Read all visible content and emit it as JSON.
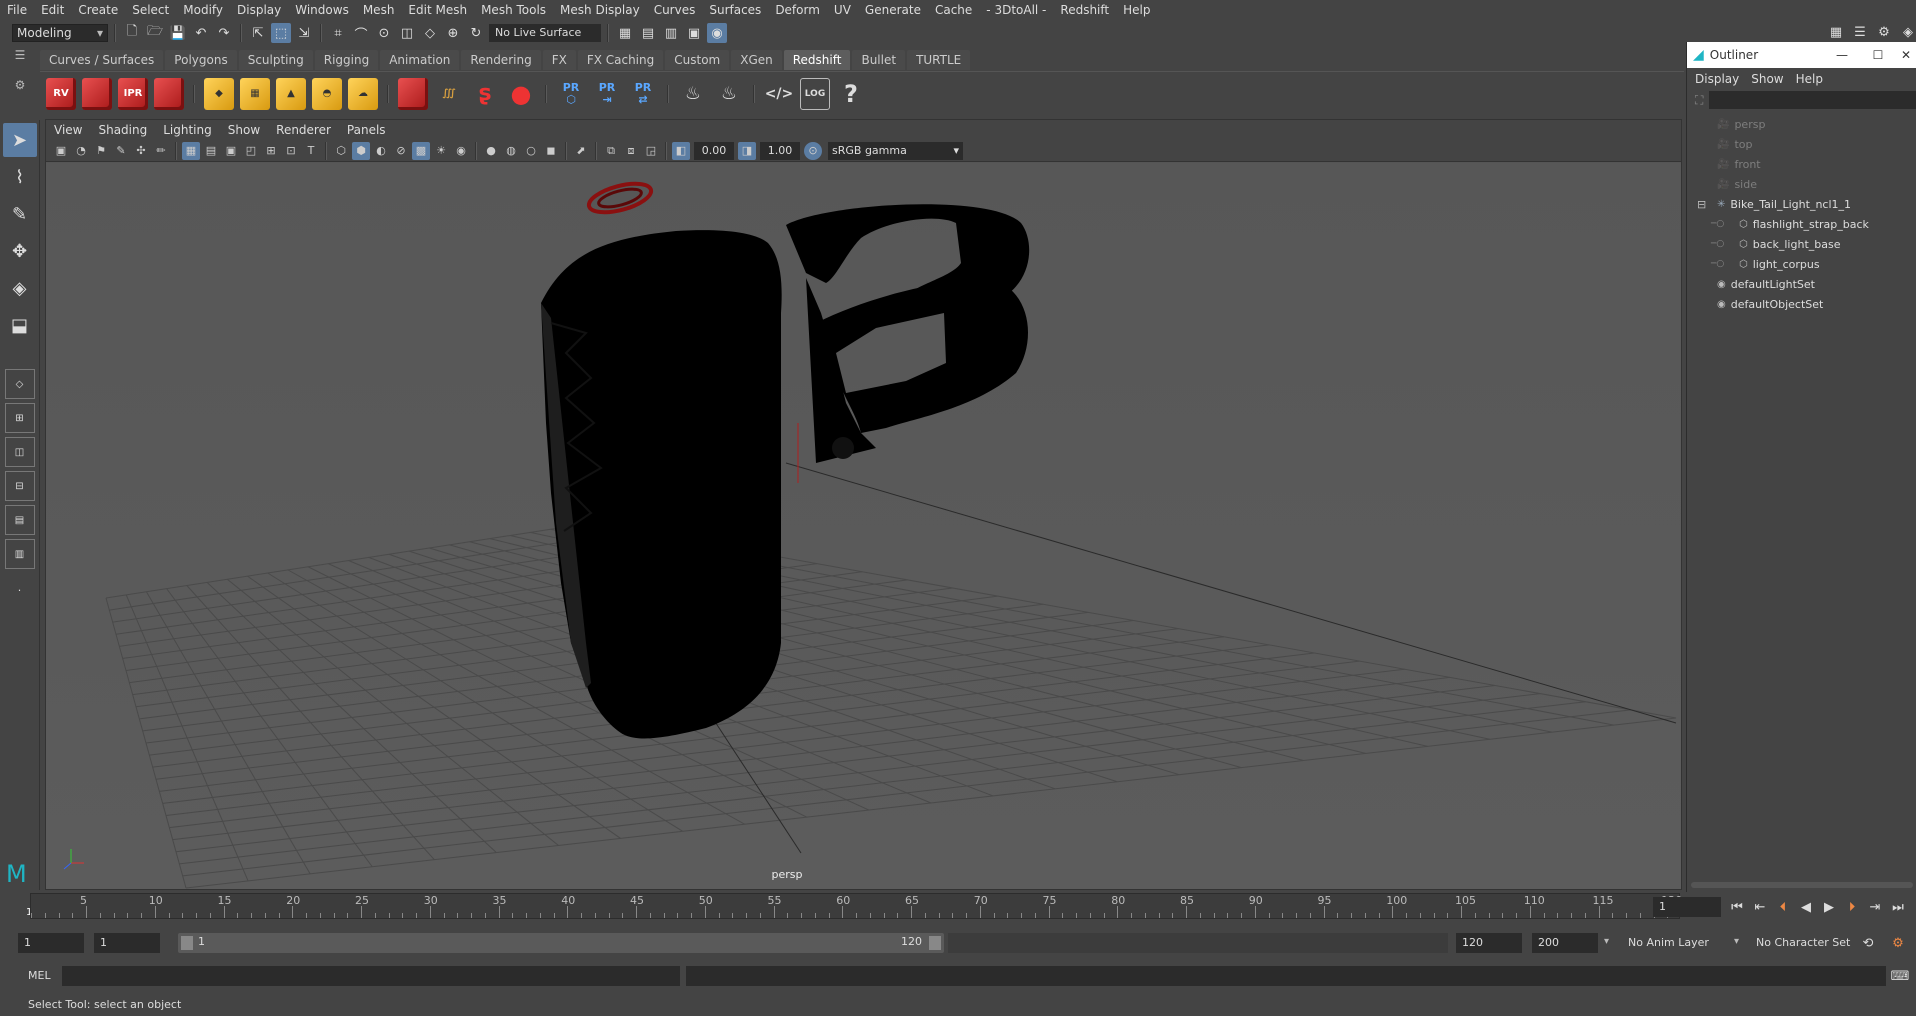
{
  "menubar": [
    "File",
    "Edit",
    "Create",
    "Select",
    "Modify",
    "Display",
    "Windows",
    "Mesh",
    "Edit Mesh",
    "Mesh Tools",
    "Mesh Display",
    "Curves",
    "Surfaces",
    "Deform",
    "UV",
    "Generate",
    "Cache",
    "- 3DtoAll -",
    "Redshift",
    "Help"
  ],
  "status": {
    "mode": "Modeling",
    "live_surface": "No Live Surface"
  },
  "shelf_tabs": [
    "Curves / Surfaces",
    "Polygons",
    "Sculpting",
    "Rigging",
    "Animation",
    "Rendering",
    "FX",
    "FX Caching",
    "Custom",
    "XGen",
    "Redshift",
    "Bullet",
    "TURTLE"
  ],
  "shelf_active": "Redshift",
  "shelf_labels": {
    "rv": "RV",
    "ipr": "IPR",
    "pr": "PR",
    "log": "LOG"
  },
  "panel_menu": [
    "View",
    "Shading",
    "Lighting",
    "Show",
    "Renderer",
    "Panels"
  ],
  "panel_tools": {
    "exposure": "0.00",
    "gamma": "1.00",
    "colorspace": "sRGB gamma"
  },
  "viewport": {
    "camera": "persp"
  },
  "outliner": {
    "title": "Outliner",
    "menu": [
      "Display",
      "Show",
      "Help"
    ],
    "items": [
      {
        "label": "persp",
        "type": "camera",
        "indent": 0,
        "dim": true
      },
      {
        "label": "top",
        "type": "camera",
        "indent": 0,
        "dim": true
      },
      {
        "label": "front",
        "type": "camera",
        "indent": 0,
        "dim": true
      },
      {
        "label": "side",
        "type": "camera",
        "indent": 0,
        "dim": true
      },
      {
        "label": "Bike_Tail_Light_ncl1_1",
        "type": "group",
        "indent": 0,
        "dim": false
      },
      {
        "label": "flashlight_strap_back",
        "type": "mesh",
        "indent": 1,
        "dim": false
      },
      {
        "label": "back_light_base",
        "type": "mesh",
        "indent": 1,
        "dim": false
      },
      {
        "label": "light_corpus",
        "type": "mesh",
        "indent": 1,
        "dim": false
      },
      {
        "label": "defaultLightSet",
        "type": "set",
        "indent": 0,
        "dim": false
      },
      {
        "label": "defaultObjectSet",
        "type": "set",
        "indent": 0,
        "dim": false
      }
    ]
  },
  "timeline": {
    "ticks": [
      "5",
      "10",
      "15",
      "20",
      "25",
      "30",
      "35",
      "40",
      "45",
      "50",
      "55",
      "60",
      "65",
      "70",
      "75",
      "80",
      "85",
      "90",
      "95",
      "100",
      "105",
      "110",
      "115",
      "120"
    ],
    "start_marker": "1",
    "current_frame": "1"
  },
  "range": {
    "start": "1",
    "anim_start": "1",
    "slider_start": "1",
    "slider_end": "120",
    "end": "120",
    "anim_end": "200",
    "anim_layer": "No Anim Layer",
    "char_set": "No Character Set"
  },
  "command": {
    "lang": "MEL"
  },
  "help": "Select Tool: select an object"
}
